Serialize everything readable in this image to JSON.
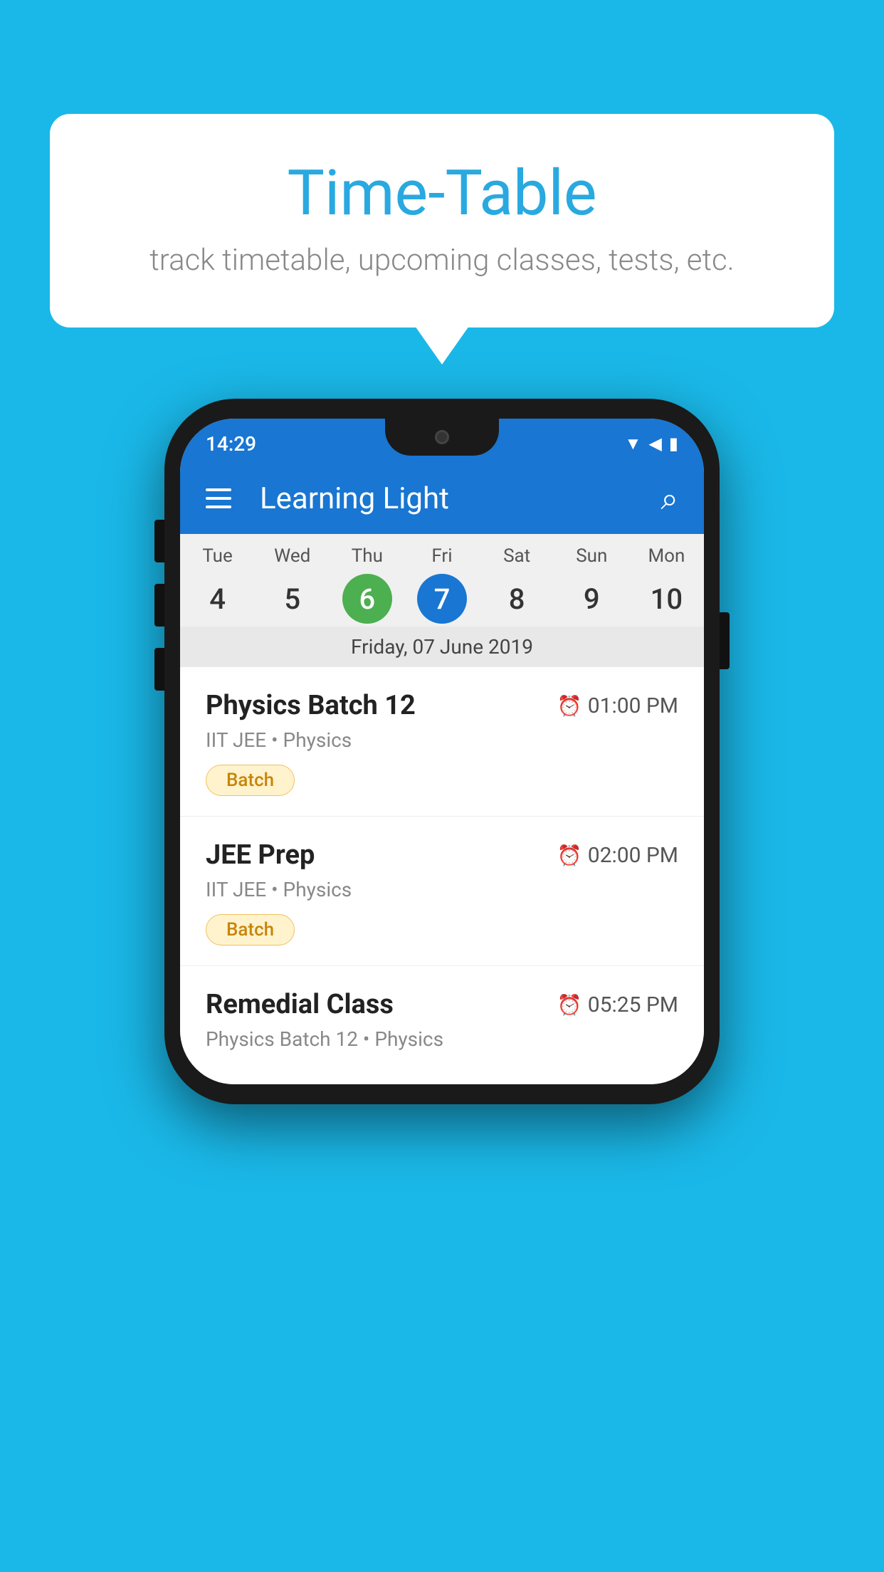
{
  "background_color": "#1ab8e8",
  "speech_bubble": {
    "title": "Time-Table",
    "subtitle": "track timetable, upcoming classes, tests, etc."
  },
  "phone": {
    "status_bar": {
      "time": "14:29"
    },
    "app_bar": {
      "title": "Learning Light"
    },
    "calendar": {
      "days": [
        {
          "name": "Tue",
          "num": "4",
          "state": "normal"
        },
        {
          "name": "Wed",
          "num": "5",
          "state": "normal"
        },
        {
          "name": "Thu",
          "num": "6",
          "state": "today"
        },
        {
          "name": "Fri",
          "num": "7",
          "state": "selected"
        },
        {
          "name": "Sat",
          "num": "8",
          "state": "normal"
        },
        {
          "name": "Sun",
          "num": "9",
          "state": "normal"
        },
        {
          "name": "Mon",
          "num": "10",
          "state": "normal"
        }
      ],
      "selected_date_label": "Friday, 07 June 2019"
    },
    "schedule": [
      {
        "title": "Physics Batch 12",
        "time": "01:00 PM",
        "subtitle": "IIT JEE • Physics",
        "badge": "Batch"
      },
      {
        "title": "JEE Prep",
        "time": "02:00 PM",
        "subtitle": "IIT JEE • Physics",
        "badge": "Batch"
      },
      {
        "title": "Remedial Class",
        "time": "05:25 PM",
        "subtitle": "Physics Batch 12 • Physics",
        "badge": null
      }
    ]
  }
}
